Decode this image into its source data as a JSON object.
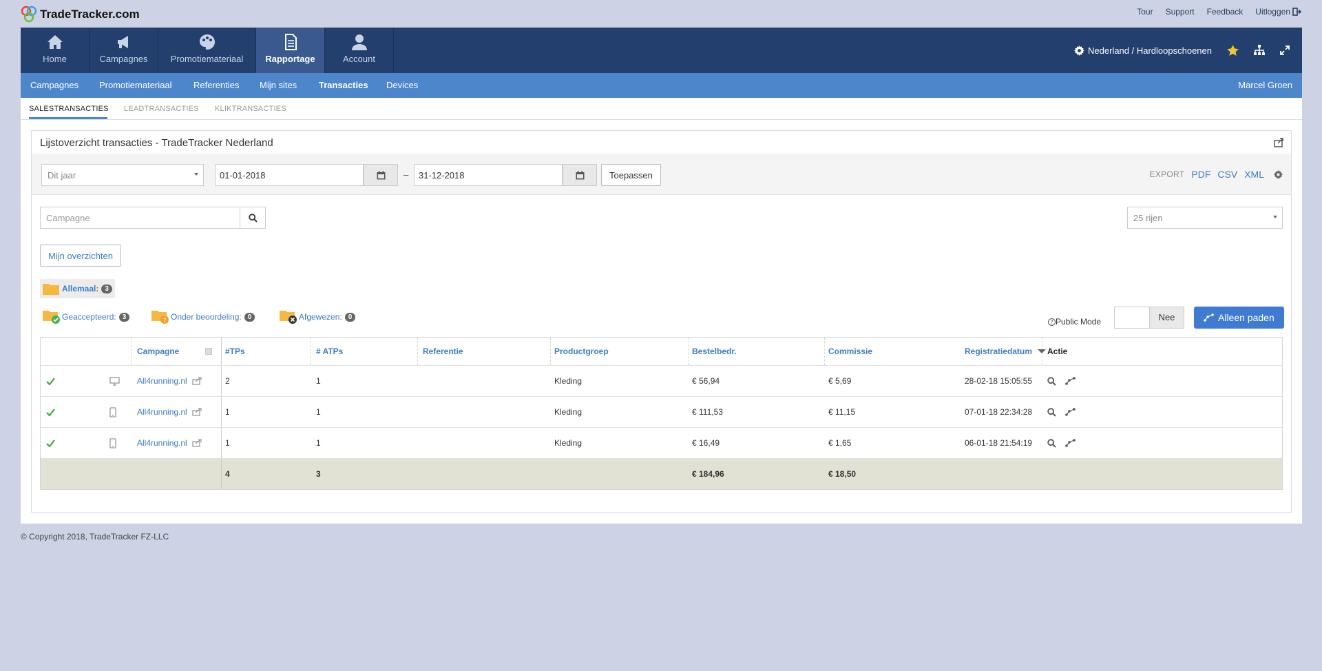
{
  "brand": {
    "name": "TradeTracker.com"
  },
  "toplinks": [
    "Tour",
    "Support",
    "Feedback",
    "Uitloggen"
  ],
  "mainnav": [
    {
      "label": "Home",
      "icon": "home-icon"
    },
    {
      "label": "Campagnes",
      "icon": "megaphone-icon"
    },
    {
      "label": "Promotiemateriaal",
      "icon": "palette-icon"
    },
    {
      "label": "Rapportage",
      "icon": "document-icon",
      "active": true
    },
    {
      "label": "Account",
      "icon": "user-icon"
    }
  ],
  "site_selector": "Nederland / Hardloopschoenen",
  "subnav": {
    "items": [
      "Campagnes",
      "Promotiemateriaal",
      "Referenties",
      "Mijn sites",
      "Transacties",
      "Devices"
    ],
    "active": "Transacties",
    "user": "Marcel Groen"
  },
  "tabs": [
    "SALESTRANSACTIES",
    "LEADTRANSACTIES",
    "KLIKTRANSACTIES"
  ],
  "panel": {
    "title": "Lijstoverzicht transacties - TradeTracker Nederland",
    "period_select": "Dit jaar",
    "date_from": "01-01-2018",
    "date_sep": "–",
    "date_to": "31-12-2018",
    "apply_label": "Toepassen",
    "export_label": "EXPORT",
    "export_formats": [
      "PDF",
      "CSV",
      "XML"
    ],
    "campaign_placeholder": "Campagne",
    "rows_select": "25 rijen",
    "overviews_label": "Mijn overzichten"
  },
  "statuses": {
    "all": {
      "label": "Allemaal:",
      "count": "3"
    },
    "accepted": {
      "label": "Geaccepteerd:",
      "count": "3"
    },
    "pending": {
      "label": "Onder beoordeling:",
      "count": "0"
    },
    "rejected": {
      "label": "Afgewezen:",
      "count": "0"
    }
  },
  "public_mode": {
    "label": "Public Mode",
    "value": "Nee"
  },
  "paths_button": "Alleen paden",
  "table": {
    "columns": [
      "Campagne",
      "#TPs",
      "# ATPs",
      "Referentie",
      "Productgroep",
      "Bestelbedr.",
      "Commissie",
      "Registratiedatum",
      "Actie"
    ],
    "rows": [
      {
        "device": "desktop-icon",
        "campaign": "All4running.nl",
        "tps": "2",
        "atps": "1",
        "ref": "",
        "group": "Kleding",
        "amount": "€ 56,94",
        "commission": "€ 5,69",
        "date": "28-02-18 15:05:55"
      },
      {
        "device": "mobile-icon",
        "campaign": "All4running.nl",
        "tps": "1",
        "atps": "1",
        "ref": "",
        "group": "Kleding",
        "amount": "€ 111,53",
        "commission": "€ 11,15",
        "date": "07-01-18 22:34:28"
      },
      {
        "device": "mobile-icon",
        "campaign": "All4running.nl",
        "tps": "1",
        "atps": "1",
        "ref": "",
        "group": "Kleding",
        "amount": "€ 16,49",
        "commission": "€ 1,65",
        "date": "06-01-18 21:54:19"
      }
    ],
    "totals": {
      "tps": "4",
      "atps": "3",
      "amount": "€ 184,96",
      "commission": "€ 18,50"
    }
  },
  "copyright": "© Copyright 2018, TradeTracker FZ-LLC",
  "colors": {
    "nav_dark": "#233f6e",
    "nav_active": "#3a5a8f",
    "subnav": "#4e86cc",
    "link": "#3b7dc4",
    "accept": "#4caf50",
    "folder": "#f5b942",
    "totals_bg": "#e1e2d4",
    "page_bg": "#cdd3e4"
  }
}
